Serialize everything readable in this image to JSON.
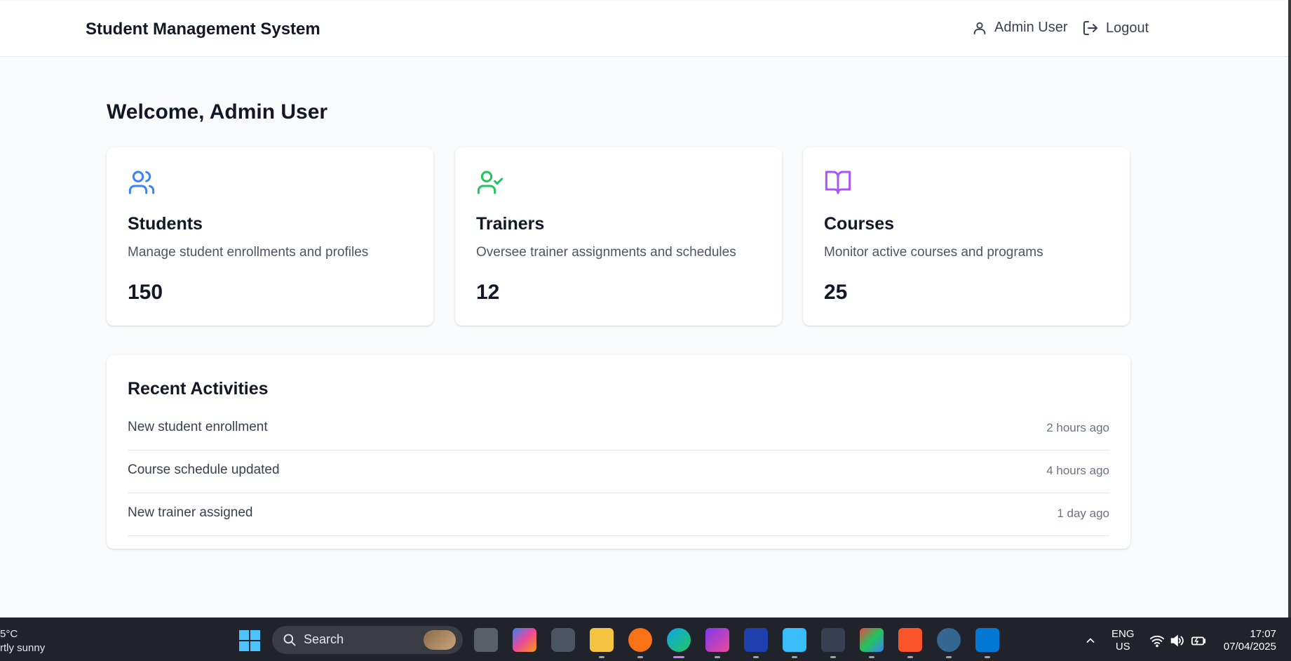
{
  "header": {
    "brand": "Student Management System",
    "user_label": "Admin User",
    "logout_label": "Logout"
  },
  "welcome": "Welcome, Admin User",
  "cards": [
    {
      "icon": "users-icon",
      "title": "Students",
      "desc": "Manage student enrollments and profiles",
      "count": "150",
      "color": "#3b82f6"
    },
    {
      "icon": "user-check-icon",
      "title": "Trainers",
      "desc": "Oversee trainer assignments and schedules",
      "count": "12",
      "color": "#22c55e"
    },
    {
      "icon": "book-open-icon",
      "title": "Courses",
      "desc": "Monitor active courses and programs",
      "count": "25",
      "color": "#a855f7"
    }
  ],
  "activities": {
    "title": "Recent Activities",
    "items": [
      {
        "text": "New student enrollment",
        "time": "2 hours ago"
      },
      {
        "text": "Course schedule updated",
        "time": "4 hours ago"
      },
      {
        "text": "New trainer assigned",
        "time": "1 day ago"
      }
    ]
  },
  "taskbar": {
    "weather_temp": "5°C",
    "weather_desc": "rtly sunny",
    "search_label": "Search",
    "lang": "ENG",
    "region": "US",
    "time": "17:07",
    "date": "07/04/2025",
    "apps": [
      "task-view-icon",
      "copilot-icon",
      "unity-icon",
      "file-explorer-icon",
      "postman-icon",
      "edge-icon",
      "intellij-icon",
      "mysql-workbench-icon",
      "notepad-icon",
      "terminal-icon",
      "git-icon",
      "brave-icon",
      "postgresql-icon",
      "vscode-icon"
    ]
  }
}
